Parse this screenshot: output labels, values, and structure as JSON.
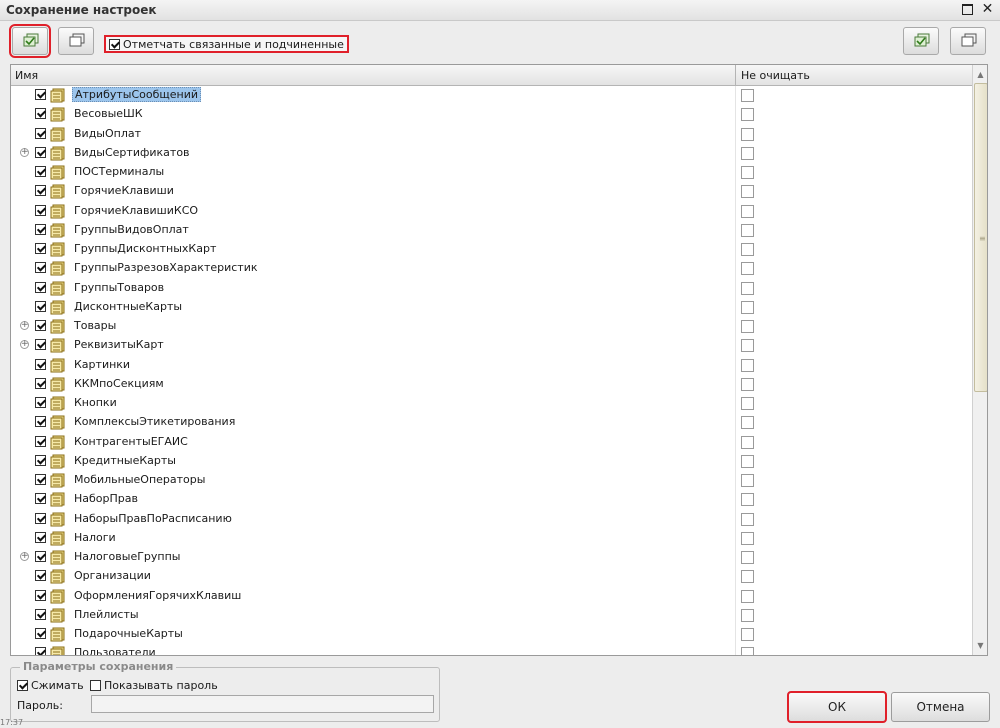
{
  "window": {
    "title": "Сохранение настроек"
  },
  "toolbar": {
    "link_checkbox_label": "Отметчать связанные и подчиненные",
    "link_checkbox_checked": true
  },
  "grid": {
    "columns": {
      "name": "Имя",
      "no_clear": "Не очищать"
    },
    "rows": [
      {
        "name": "АтрибутыСообщений",
        "checked": true,
        "expandable": false,
        "selected": true
      },
      {
        "name": "ВесовыеШК",
        "checked": true,
        "expandable": false
      },
      {
        "name": "ВидыОплат",
        "checked": true,
        "expandable": false
      },
      {
        "name": "ВидыСертификатов",
        "checked": true,
        "expandable": true
      },
      {
        "name": "ПОСТерминалы",
        "checked": true,
        "expandable": false
      },
      {
        "name": "ГорячиеКлавиши",
        "checked": true,
        "expandable": false
      },
      {
        "name": "ГорячиеКлавишиКСО",
        "checked": true,
        "expandable": false
      },
      {
        "name": "ГруппыВидовОплат",
        "checked": true,
        "expandable": false
      },
      {
        "name": "ГруппыДисконтныхКарт",
        "checked": true,
        "expandable": false
      },
      {
        "name": "ГруппыРазрезовХарактеристик",
        "checked": true,
        "expandable": false
      },
      {
        "name": "ГруппыТоваров",
        "checked": true,
        "expandable": false
      },
      {
        "name": "ДисконтныеКарты",
        "checked": true,
        "expandable": false
      },
      {
        "name": "Товары",
        "checked": true,
        "expandable": true
      },
      {
        "name": "РеквизитыКарт",
        "checked": true,
        "expandable": true
      },
      {
        "name": "Картинки",
        "checked": true,
        "expandable": false
      },
      {
        "name": "ККМпоСекциям",
        "checked": true,
        "expandable": false
      },
      {
        "name": "Кнопки",
        "checked": true,
        "expandable": false
      },
      {
        "name": "КомплексыЭтикетирования",
        "checked": true,
        "expandable": false
      },
      {
        "name": "КонтрагентыЕГАИС",
        "checked": true,
        "expandable": false
      },
      {
        "name": "КредитныеКарты",
        "checked": true,
        "expandable": false
      },
      {
        "name": "МобильныеОператоры",
        "checked": true,
        "expandable": false
      },
      {
        "name": "НаборПрав",
        "checked": true,
        "expandable": false
      },
      {
        "name": "НаборыПравПоРасписанию",
        "checked": true,
        "expandable": false
      },
      {
        "name": "Налоги",
        "checked": true,
        "expandable": false
      },
      {
        "name": "НалоговыеГруппы",
        "checked": true,
        "expandable": true
      },
      {
        "name": "Организации",
        "checked": true,
        "expandable": false
      },
      {
        "name": "ОформленияГорячихКлавиш",
        "checked": true,
        "expandable": false
      },
      {
        "name": "Плейлисты",
        "checked": true,
        "expandable": false
      },
      {
        "name": "ПодарочныеКарты",
        "checked": true,
        "expandable": false
      },
      {
        "name": "Пользователи",
        "checked": true,
        "expandable": false
      }
    ]
  },
  "params": {
    "legend": "Параметры сохранения",
    "compress_label": "Сжимать",
    "compress_checked": true,
    "show_password_label": "Показывать пароль",
    "show_password_checked": false,
    "password_label": "Пароль:",
    "password_value": ""
  },
  "buttons": {
    "ok": "ОК",
    "cancel": "Отмена"
  },
  "status": {
    "clock": "17:37"
  },
  "icons": {
    "row_icon": "catalog-table-icon",
    "toolbar_check_all": "check-all-icon",
    "toolbar_uncheck_all": "uncheck-all-icon"
  },
  "colors": {
    "highlight_red": "#e0202a",
    "selection_blue": "#9cc5ec"
  }
}
